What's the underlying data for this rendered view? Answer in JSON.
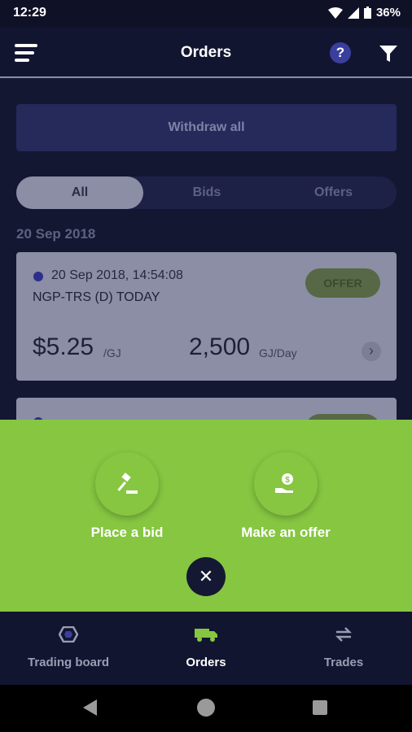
{
  "status_bar": {
    "time": "12:29",
    "battery": "36%"
  },
  "header": {
    "title": "Orders"
  },
  "main": {
    "withdraw_label": "Withdraw all",
    "tabs": [
      {
        "label": "All"
      },
      {
        "label": "Bids"
      },
      {
        "label": "Offers"
      }
    ],
    "date_header": "20 Sep 2018",
    "orders": [
      {
        "timestamp": "20 Sep 2018, 14:54:08",
        "name": "NGP-TRS (D) TODAY",
        "type": "OFFER",
        "price": "$5.25",
        "price_unit": "/GJ",
        "quantity": "2,500",
        "quantity_unit": "GJ/Day"
      }
    ]
  },
  "action_sheet": {
    "place_bid_label": "Place a bid",
    "make_offer_label": "Make an offer",
    "close_glyph": "✕"
  },
  "bottom_nav": {
    "items": [
      {
        "label": "Trading board",
        "icon": "hexagon-icon"
      },
      {
        "label": "Orders",
        "icon": "truck-icon"
      },
      {
        "label": "Trades",
        "icon": "swap-arrows-icon"
      }
    ]
  },
  "colors": {
    "accent_green": "#86c641",
    "background": "#151833",
    "primary_blue": "#3a3f9e"
  }
}
